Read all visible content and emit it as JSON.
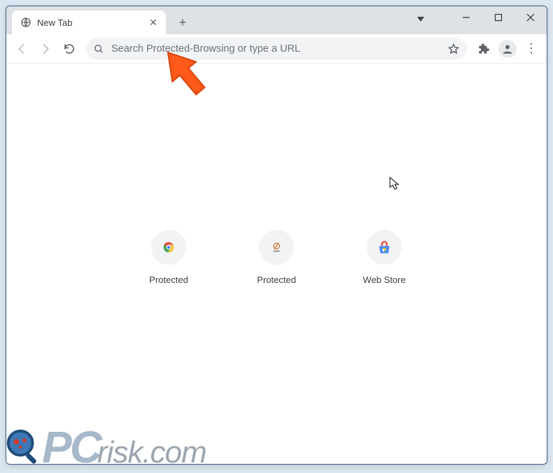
{
  "tab": {
    "title": "New Tab"
  },
  "omnibox": {
    "placeholder": "Search Protected-Browsing or type a URL"
  },
  "shortcuts": [
    {
      "label": "Protected"
    },
    {
      "label": "Protected"
    },
    {
      "label": "Web Store"
    }
  ],
  "watermark": {
    "pc": "PC",
    "risk": "risk.com"
  }
}
